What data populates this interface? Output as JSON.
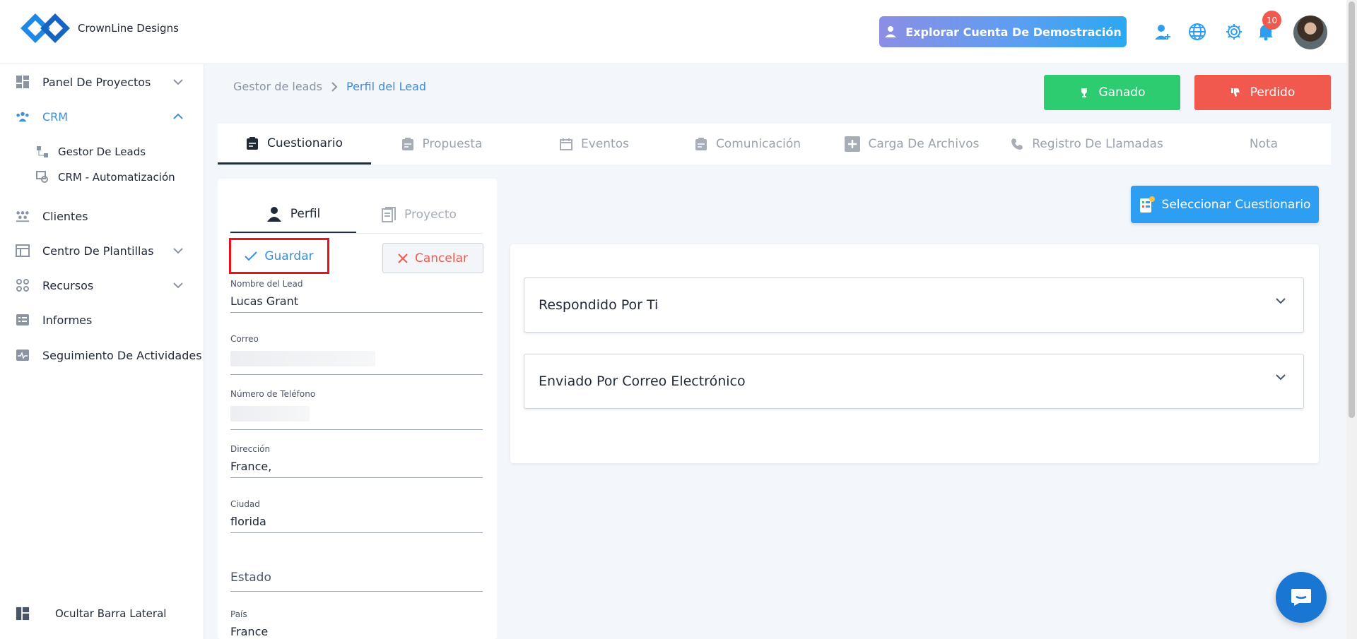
{
  "brand": {
    "name": "CrownLine Designs"
  },
  "header": {
    "demo_label": "Explorar Cuenta De Demostración",
    "notification_count": "10"
  },
  "sidebar": {
    "items": [
      {
        "label": "Panel De Proyectos",
        "icon": "dashboard-icon"
      },
      {
        "label": "CRM",
        "icon": "crm-icon"
      },
      {
        "label": "Clientes",
        "icon": "clients-icon"
      },
      {
        "label": "Centro De Plantillas",
        "icon": "template-icon"
      },
      {
        "label": "Recursos",
        "icon": "resources-icon"
      },
      {
        "label": "Informes",
        "icon": "reports-icon"
      },
      {
        "label": "Seguimiento De Actividades",
        "icon": "activity-icon"
      }
    ],
    "crm_sub": [
      {
        "label": "Gestor De Leads"
      },
      {
        "label": "CRM - Automatización"
      }
    ],
    "hide_label": "Ocultar Barra Lateral"
  },
  "breadcrumb": {
    "parent": "Gestor de leads",
    "current": "Perfil del Lead"
  },
  "status": {
    "won": "Ganado",
    "lost": "Perdido"
  },
  "tabs": [
    {
      "label": "Cuestionario"
    },
    {
      "label": "Propuesta"
    },
    {
      "label": "Eventos"
    },
    {
      "label": "Comunicación"
    },
    {
      "label": "Carga De Archivos"
    },
    {
      "label": "Registro De Llamadas"
    },
    {
      "label": "Nota"
    }
  ],
  "profile": {
    "tab_profile": "Perfil",
    "tab_project": "Proyecto",
    "save": "Guardar",
    "cancel": "Cancelar",
    "fields": {
      "name_label": "Nombre del Lead",
      "name_value": "Lucas Grant",
      "email_label": "Correo",
      "phone_label": "Número de Teléfono",
      "address_label": "Dirección",
      "address_value": "France,",
      "city_label": "Ciudad",
      "city_value": "florida",
      "state_label": "Estado",
      "country_label": "País",
      "country_value": "France"
    }
  },
  "questionnaire": {
    "select_label": "Seleccionar Cuestionario",
    "sections": [
      {
        "label": "Respondido Por Ti"
      },
      {
        "label": "Enviado Por Correo Electrónico"
      }
    ]
  },
  "colors": {
    "accent": "#3c8ddb",
    "won": "#2ecc71",
    "lost": "#f1584e",
    "select": "#2e9ef2"
  }
}
